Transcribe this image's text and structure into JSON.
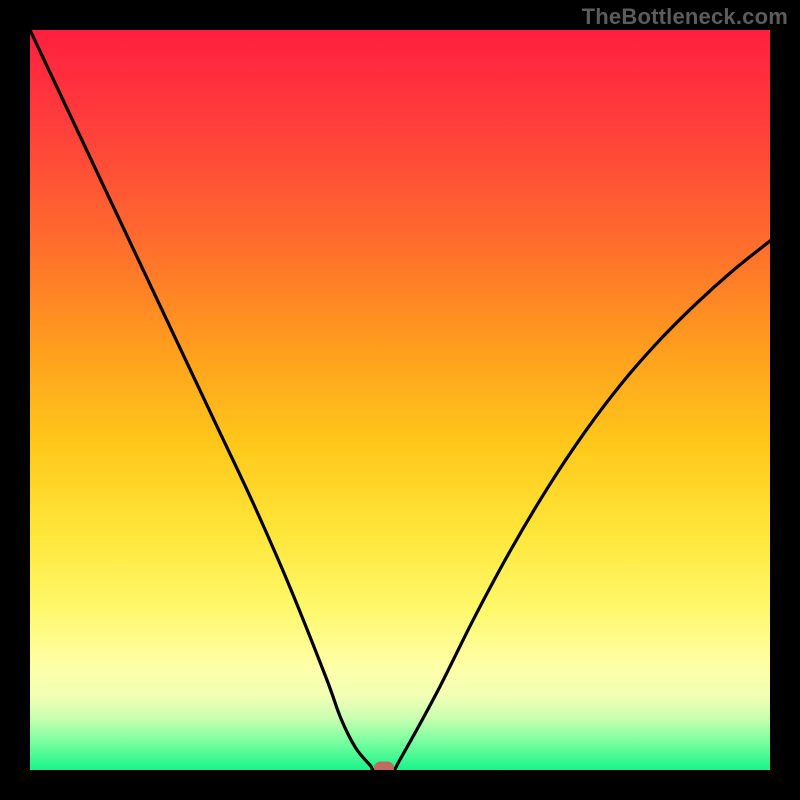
{
  "watermark": "TheBottleneck.com",
  "chart_data": {
    "type": "line",
    "title": "",
    "xlabel": "",
    "ylabel": "",
    "xlim": [
      0,
      100
    ],
    "ylim": [
      0,
      100
    ],
    "grid": false,
    "legend": false,
    "series": [
      {
        "name": "bottleneck-curve",
        "x": [
          0,
          5,
          10,
          15,
          20,
          25,
          30,
          35,
          40,
          42,
          44,
          46,
          46.5,
          49,
          50,
          55,
          60,
          65,
          70,
          75,
          80,
          85,
          90,
          95,
          100
        ],
        "y": [
          100,
          89.4,
          78.8,
          68.2,
          57.6,
          47.0,
          36.4,
          25.0,
          12.5,
          7.0,
          3.0,
          0.6,
          0.0,
          0.0,
          1.4,
          10.5,
          20.5,
          29.8,
          38.2,
          45.7,
          52.3,
          58.0,
          63.0,
          67.5,
          71.5
        ]
      }
    ],
    "annotations": [
      {
        "name": "optimum-marker",
        "x": 47.8,
        "y": 0.3
      }
    ],
    "colors": {
      "curve": "#000000",
      "marker": "#c06a5d",
      "gradient_top": "#ff1f3f",
      "gradient_bottom": "#18f58a"
    }
  }
}
